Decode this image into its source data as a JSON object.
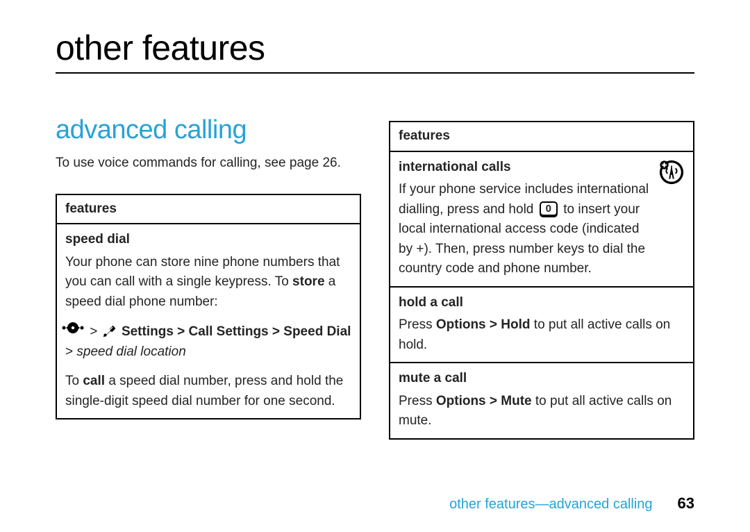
{
  "accentColor": "#27a2d6",
  "page": {
    "title": "other features",
    "footerBreadcrumb": "other features—advanced calling",
    "pageNumber": "63"
  },
  "section": {
    "heading": "advanced calling",
    "intro_a": "To use voice commands for calling, see page ",
    "intro_page": "26",
    "intro_b": "."
  },
  "leftBox": {
    "header": "features",
    "speedDial": {
      "title": "speed dial",
      "desc_a": "Your phone can store nine phone numbers that you can call with a single keypress. To ",
      "desc_bold": "store",
      "desc_b": " a speed dial phone number:",
      "nav_sep1": " > ",
      "nav_settings": "Settings",
      "nav_sep2": " > ",
      "nav_callSettings": "Call Settings",
      "nav_sep3": " > ",
      "nav_speedDial": "Speed Dial",
      "nav_sep4": " > ",
      "nav_ital": "speed dial location",
      "call_a": "To ",
      "call_bold": "call",
      "call_b": " a speed dial number, press and hold the single-digit speed dial number for one second."
    }
  },
  "rightBox": {
    "header": "features",
    "intl": {
      "title": "international calls",
      "p_a": "If your phone service includes international dialling, press and hold ",
      "key": "0",
      "p_b": " to insert your local international access code (indicated by +). Then, press number keys to dial the country code and phone number."
    },
    "hold": {
      "title": "hold a call",
      "p_a": "Press ",
      "kw1": "Options",
      "sep": " > ",
      "kw2": "Hold",
      "p_b": " to put all active calls on hold."
    },
    "mute": {
      "title": "mute a call",
      "p_a": "Press ",
      "kw1": "Options",
      "sep": " > ",
      "kw2": "Mute",
      "p_b": " to put all active calls on mute."
    }
  }
}
